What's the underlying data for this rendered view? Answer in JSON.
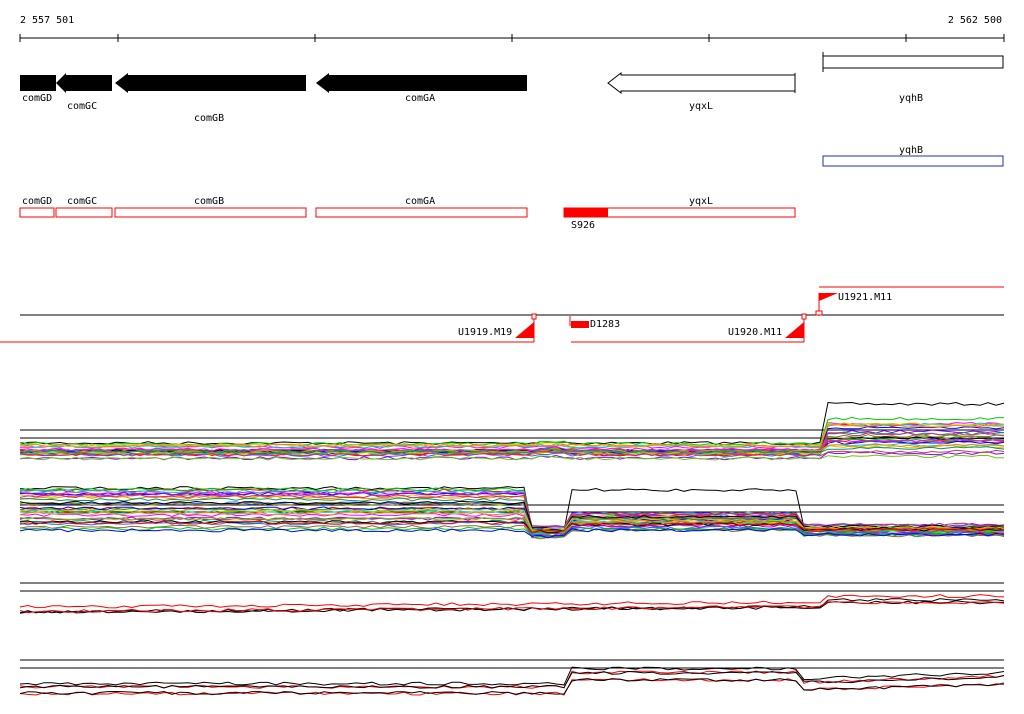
{
  "ruler": {
    "start_label": "2 557 501",
    "end_label": "2 562 500"
  },
  "genes_track": [
    {
      "name": "comGD",
      "strand": "-",
      "filled": true
    },
    {
      "name": "comGC",
      "strand": "-",
      "filled": true
    },
    {
      "name": "comGB",
      "strand": "-",
      "filled": true
    },
    {
      "name": "comGA",
      "strand": "-",
      "filled": true
    },
    {
      "name": "yqxL",
      "strand": "-",
      "filled": false
    },
    {
      "name": "yqhB",
      "strand": "+",
      "filled": false
    }
  ],
  "blue_feature": {
    "name": "yqhB",
    "color": "#1f2fa8"
  },
  "red_boxes": [
    {
      "name": "comGD"
    },
    {
      "name": "comGC"
    },
    {
      "name": "comGB"
    },
    {
      "name": "comGA"
    },
    {
      "name": "yqxL"
    }
  ],
  "red_box_marker": {
    "name": "S926",
    "color": "#ff0000"
  },
  "transcripts": [
    {
      "name": "U1919.M19"
    },
    {
      "name": "D1283"
    },
    {
      "name": "U1920.M11"
    },
    {
      "name": "U1921.M11"
    }
  ],
  "colors": {
    "gene_fill": "#000000",
    "red": "#ff0000",
    "track_line": "#000000"
  },
  "expression_panels": [
    "panel-1",
    "panel-2",
    "panel-3",
    "panel-4"
  ]
}
